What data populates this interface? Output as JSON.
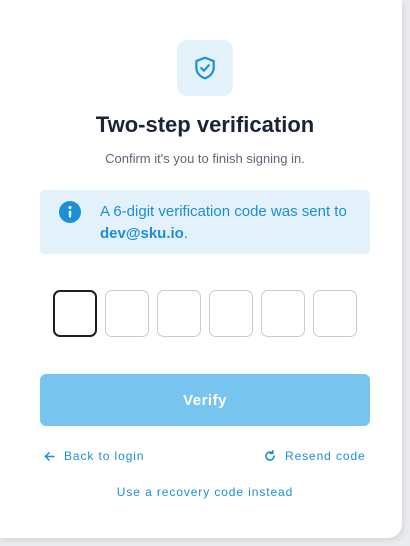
{
  "header": {
    "icon": "shield-check-icon",
    "title": "Two-step verification",
    "subtitle": "Confirm it's you to finish signing in."
  },
  "alert": {
    "icon": "info-icon",
    "text_before": "A 6-digit verification code was sent to ",
    "email": "dev@sku.io",
    "text_after": "."
  },
  "code": {
    "digits": [
      "",
      "",
      "",
      "",
      "",
      ""
    ],
    "active_index": 0
  },
  "actions": {
    "verify_label": "Verify",
    "back_label": "Back to login",
    "back_icon": "arrow-left-icon",
    "resend_label": "Resend code",
    "resend_icon": "refresh-icon",
    "recovery_label": "Use a recovery code instead"
  },
  "colors": {
    "accent": "#1b8fd8",
    "accent_soft": "#e3f1fb",
    "button_disabled": "#77c5ef",
    "title": "#1b2436"
  }
}
